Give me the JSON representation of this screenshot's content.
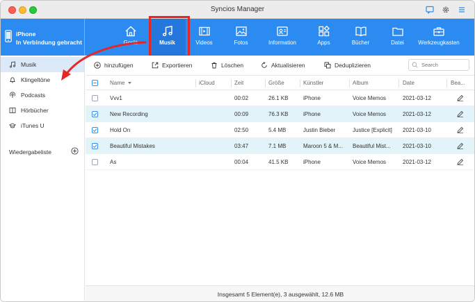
{
  "window": {
    "title": "Syncios Manager"
  },
  "device": {
    "name": "iPhone",
    "status": "In Verbindung gebracht"
  },
  "nav": [
    {
      "label": "Gerät",
      "icon": "home-icon"
    },
    {
      "label": "Musik",
      "icon": "music-icon",
      "active": true
    },
    {
      "label": "Videos",
      "icon": "video-icon"
    },
    {
      "label": "Fotos",
      "icon": "photo-icon"
    },
    {
      "label": "Information",
      "icon": "contact-icon"
    },
    {
      "label": "Apps",
      "icon": "apps-icon"
    },
    {
      "label": "Bücher",
      "icon": "book-icon"
    },
    {
      "label": "Datei",
      "icon": "folder-icon"
    },
    {
      "label": "Werkzeugkasten",
      "icon": "toolbox-icon"
    }
  ],
  "sidebar": {
    "items": [
      {
        "label": "Musik",
        "icon": "music-note-icon",
        "active": true
      },
      {
        "label": "Klingeltöne",
        "icon": "bell-icon"
      },
      {
        "label": "Podcasts",
        "icon": "podcast-icon"
      },
      {
        "label": "Hörbücher",
        "icon": "audiobook-icon"
      },
      {
        "label": "iTunes U",
        "icon": "graduation-cap-icon"
      }
    ],
    "playlist_label": "Wiedergabeliste"
  },
  "toolbar": {
    "add": "hinzufügen",
    "export": "Exportieren",
    "delete": "Löschen",
    "refresh": "Aktualisieren",
    "dedupe": "Deduplizieren",
    "search_placeholder": "Search"
  },
  "table": {
    "headers": {
      "name": "Name",
      "icloud": "iCloud",
      "time": "Zeit",
      "size": "Größe",
      "artist": "Künstler",
      "album": "Album",
      "date": "Date",
      "edit": "Bea..."
    },
    "rows": [
      {
        "name": "Vvv1",
        "icloud": "",
        "time": "00:02",
        "size": "26.1 KB",
        "artist": "iPhone",
        "album": "Voice Memos",
        "date": "2021-03-12",
        "selected": false
      },
      {
        "name": "New Recording",
        "icloud": "",
        "time": "00:09",
        "size": "76.3 KB",
        "artist": "iPhone",
        "album": "Voice Memos",
        "date": "2021-03-12",
        "selected": true
      },
      {
        "name": "Hold On",
        "icloud": "",
        "time": "02:50",
        "size": "5.4 MB",
        "artist": "Justin Bieber",
        "album": "Justice [Explicit]",
        "date": "2021-03-10",
        "selected": true
      },
      {
        "name": "Beautiful Mistakes",
        "icloud": "",
        "time": "03:47",
        "size": "7.1 MB",
        "artist": "Maroon 5 & M...",
        "album": "Beautiful Mist...",
        "date": "2021-03-10",
        "selected": true
      },
      {
        "name": "As",
        "icloud": "",
        "time": "00:04",
        "size": "41.5 KB",
        "artist": "iPhone",
        "album": "Voice Memos",
        "date": "2021-03-12",
        "selected": false
      }
    ]
  },
  "status": {
    "text": "Insgesamt 5 Element(e), 3 ausgewählt, 12.6 MB"
  },
  "colors": {
    "header_blue": "#2c8bf0",
    "highlight_red": "#e52727",
    "selected_row": "#e2f3f9"
  }
}
